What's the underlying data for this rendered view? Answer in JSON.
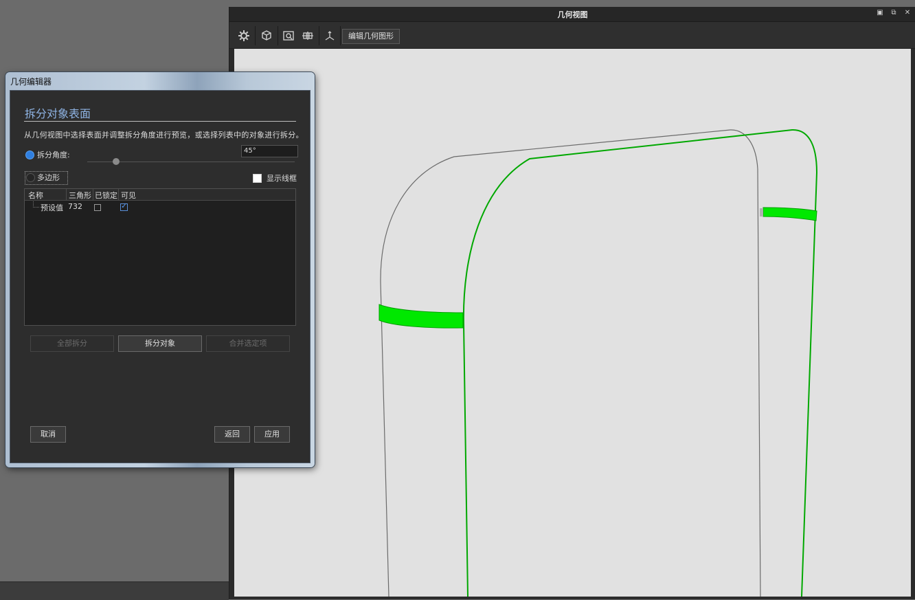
{
  "view": {
    "title": "几何视图",
    "toolbar": {
      "icons": [
        "gear-icon",
        "cube-icon",
        "zoom-fit-icon",
        "grid-icon",
        "axes-icon"
      ],
      "edit_geometry_label": "编辑几何图形"
    },
    "window_controls": [
      "minimize",
      "restore",
      "close"
    ],
    "colors": {
      "viewport_bg": "#e1e1e1",
      "split_highlight": "#00dd00",
      "outline": "#6a6a6a"
    }
  },
  "dialog": {
    "title": "几何编辑器",
    "heading": "拆分对象表面",
    "description": "从几何视图中选择表面并调整拆分角度进行预览，或选择列表中的对象进行拆分。",
    "split_angle_label": "拆分角度:",
    "split_angle_value": "45°",
    "slider_value_deg": 45,
    "polygon_label": "多边形",
    "show_wireframe_label": "显示线框",
    "table": {
      "columns": [
        "名称",
        "三角形",
        "已锁定",
        "可见"
      ],
      "rows": [
        {
          "name": "预设值",
          "triangles": "732",
          "locked": false,
          "visible": true
        }
      ]
    },
    "buttons": {
      "split_all": "全部拆分",
      "split_object": "拆分对象",
      "merge_selected": "合并选定项",
      "cancel": "取消",
      "back": "返回",
      "apply": "应用"
    }
  }
}
